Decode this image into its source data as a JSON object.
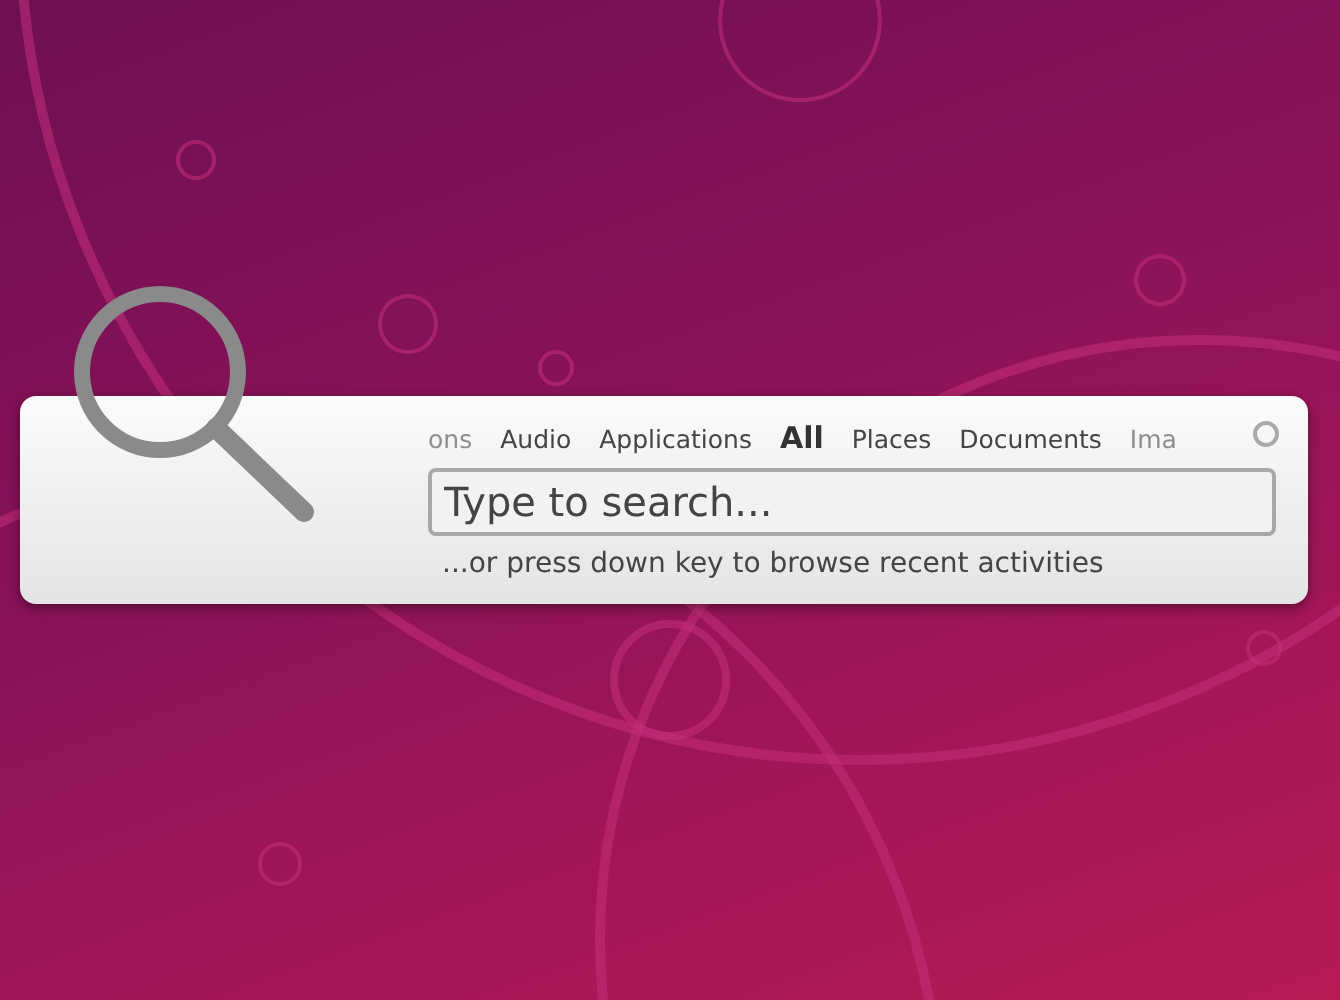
{
  "tabs": [
    {
      "label": "ons",
      "selected": false,
      "faded": true
    },
    {
      "label": "Audio",
      "selected": false,
      "faded": false
    },
    {
      "label": "Applications",
      "selected": false,
      "faded": false
    },
    {
      "label": "All",
      "selected": true,
      "faded": false
    },
    {
      "label": "Places",
      "selected": false,
      "faded": false
    },
    {
      "label": "Documents",
      "selected": false,
      "faded": false
    },
    {
      "label": "Ima",
      "selected": false,
      "faded": true
    }
  ],
  "search": {
    "placeholder": "Type to search..."
  },
  "hint": "...or press down key to browse recent activities"
}
